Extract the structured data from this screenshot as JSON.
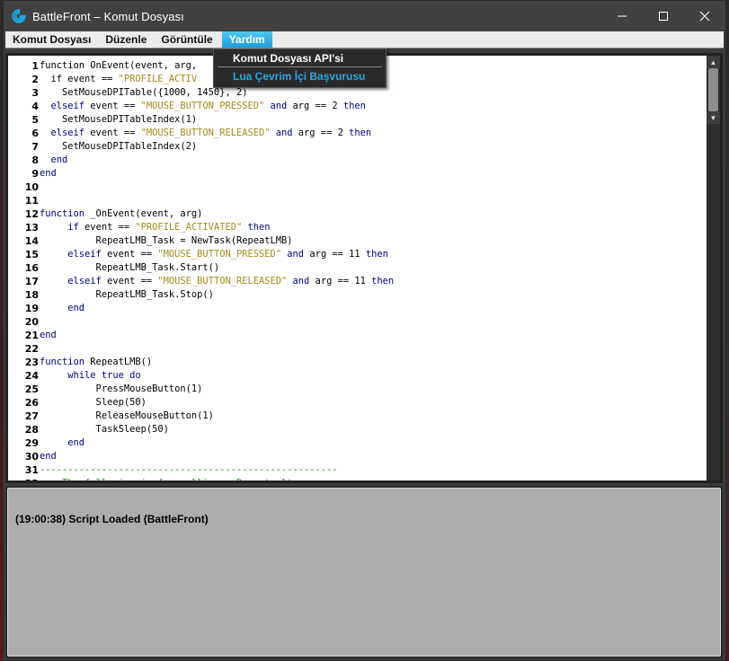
{
  "window": {
    "title": "BattleFront – Komut Dosyası",
    "accent": "#1b9ed8"
  },
  "controls": {
    "minimize": "—",
    "maximize": "☐",
    "close": "✕"
  },
  "menu": [
    {
      "label": "Komut Dosyası"
    },
    {
      "label": "Düzenle"
    },
    {
      "label": "Görüntüle"
    },
    {
      "label": "Yardım",
      "active": true
    }
  ],
  "dropdown": {
    "items": [
      {
        "label": "Komut Dosyası API'si"
      },
      {
        "label": "Lua Çevrim İçi Başvurusu"
      }
    ]
  },
  "editor": {
    "lines": [
      [
        [
          "p",
          "function OnEvent(event, arg, "
        ]
      ],
      [
        [
          "p",
          "  if event == "
        ],
        [
          "s",
          "\"PROFILE_ACTIV"
        ]
      ],
      [
        [
          "p",
          "    SetMouseDPITable({1000, 1450}, 2)"
        ]
      ],
      [
        [
          "k",
          "  elseif"
        ],
        [
          "p",
          " event == "
        ],
        [
          "s",
          "\"MOUSE_BUTTON_PRESSED\""
        ],
        [
          "k",
          " and"
        ],
        [
          "p",
          " arg == 2 "
        ],
        [
          "k",
          "then"
        ]
      ],
      [
        [
          "p",
          "    SetMouseDPITableIndex(1)"
        ]
      ],
      [
        [
          "k",
          "  elseif"
        ],
        [
          "p",
          " event == "
        ],
        [
          "s",
          "\"MOUSE_BUTTON_RELEASED\""
        ],
        [
          "k",
          " and"
        ],
        [
          "p",
          " arg == 2 "
        ],
        [
          "k",
          "then"
        ]
      ],
      [
        [
          "p",
          "    SetMouseDPITableIndex(2)"
        ]
      ],
      [
        [
          "k",
          "  end"
        ]
      ],
      [
        [
          "k",
          "end"
        ]
      ],
      [
        [
          "p",
          ""
        ]
      ],
      [
        [
          "p",
          ""
        ]
      ],
      [
        [
          "k",
          "function"
        ],
        [
          "p",
          " _OnEvent(event, arg)"
        ]
      ],
      [
        [
          "k",
          "     if"
        ],
        [
          "p",
          " event == "
        ],
        [
          "s",
          "\"PROFILE_ACTIVATED\""
        ],
        [
          "k",
          " then"
        ]
      ],
      [
        [
          "p",
          "          RepeatLMB_Task = NewTask(RepeatLMB)"
        ]
      ],
      [
        [
          "k",
          "     elseif"
        ],
        [
          "p",
          " event == "
        ],
        [
          "s",
          "\"MOUSE_BUTTON_PRESSED\""
        ],
        [
          "k",
          " and"
        ],
        [
          "p",
          " arg == 11 "
        ],
        [
          "k",
          "then"
        ]
      ],
      [
        [
          "p",
          "          RepeatLMB_Task.Start()"
        ]
      ],
      [
        [
          "k",
          "     elseif"
        ],
        [
          "p",
          " event == "
        ],
        [
          "s",
          "\"MOUSE_BUTTON_RELEASED\""
        ],
        [
          "k",
          " and"
        ],
        [
          "p",
          " arg == 11 "
        ],
        [
          "k",
          "then"
        ]
      ],
      [
        [
          "p",
          "          RepeatLMB_Task.Stop()"
        ]
      ],
      [
        [
          "k",
          "     end"
        ]
      ],
      [
        [
          "p",
          ""
        ]
      ],
      [
        [
          "k",
          "end"
        ]
      ],
      [
        [
          "p",
          ""
        ]
      ],
      [
        [
          "k",
          "function"
        ],
        [
          "p",
          " RepeatLMB()"
        ]
      ],
      [
        [
          "k",
          "     while true do"
        ]
      ],
      [
        [
          "p",
          "          PressMouseButton(1)"
        ]
      ],
      [
        [
          "p",
          "          Sleep(50)"
        ]
      ],
      [
        [
          "p",
          "          ReleaseMouseButton(1)"
        ]
      ],
      [
        [
          "p",
          "          TaskSleep(50)"
        ]
      ],
      [
        [
          "k",
          "     end"
        ]
      ],
      [
        [
          "k",
          "end"
        ]
      ],
      [
        [
          "c",
          "-----------------------------------------------------"
        ]
      ],
      [
        [
          "c",
          "    The following is for polling.  Do not alter"
        ]
      ]
    ]
  },
  "console": {
    "text": "(19:00:38) Script Loaded (BattleFront)"
  }
}
